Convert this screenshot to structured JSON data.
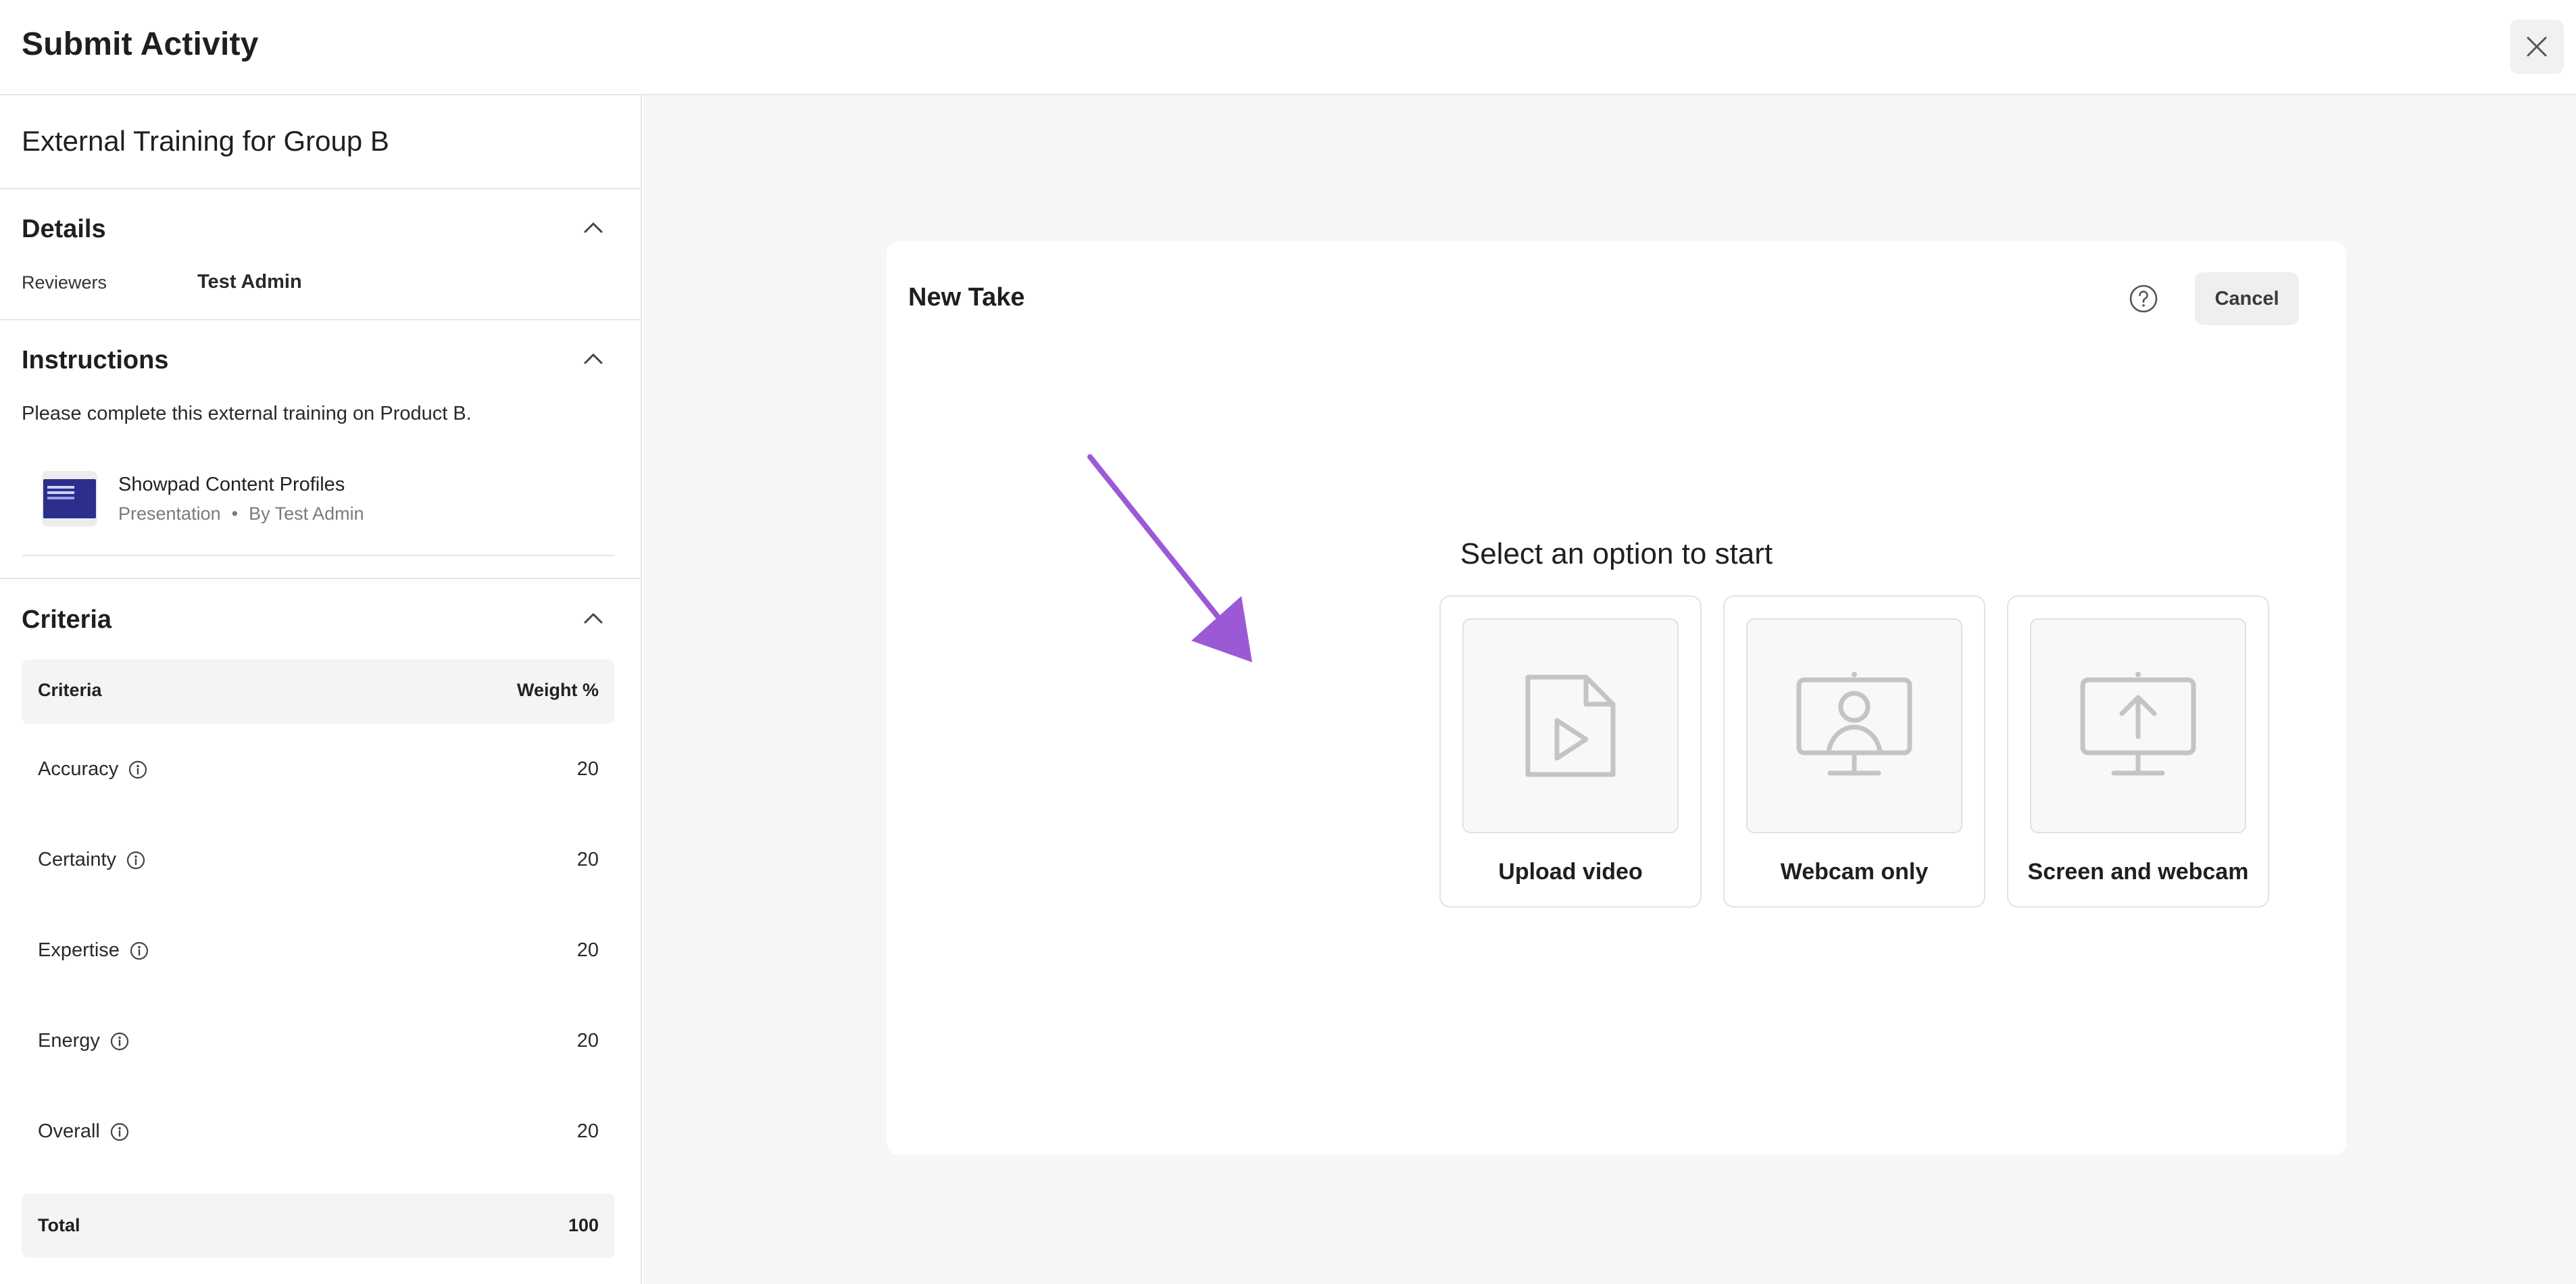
{
  "header": {
    "title": "Submit Activity"
  },
  "activity": {
    "name": "External Training for Group B"
  },
  "details": {
    "title": "Details",
    "reviewers_label": "Reviewers",
    "reviewers_value": "Test Admin"
  },
  "instructions": {
    "title": "Instructions",
    "text": "Please complete this external training on Product B.",
    "content": {
      "title": "Showpad Content Profiles",
      "type": "Presentation",
      "dot": "•",
      "author": "By Test Admin"
    }
  },
  "criteria": {
    "title": "Criteria",
    "col_criteria": "Criteria",
    "col_weight": "Weight %",
    "rows": [
      {
        "name": "Accuracy",
        "weight": "20"
      },
      {
        "name": "Certainty",
        "weight": "20"
      },
      {
        "name": "Expertise",
        "weight": "20"
      },
      {
        "name": "Energy",
        "weight": "20"
      },
      {
        "name": "Overall",
        "weight": "20"
      }
    ],
    "total_label": "Total",
    "total_value": "100"
  },
  "take": {
    "title": "New Take",
    "cancel_label": "Cancel",
    "prompt": "Select an option to start",
    "options": [
      {
        "label": "Upload video",
        "icon": "video-file-icon"
      },
      {
        "label": "Webcam only",
        "icon": "webcam-monitor-icon"
      },
      {
        "label": "Screen and webcam",
        "icon": "screen-share-monitor-icon"
      }
    ]
  },
  "colors": {
    "arrow": "#9b59d6",
    "icon_gray": "#c4c4c4"
  }
}
